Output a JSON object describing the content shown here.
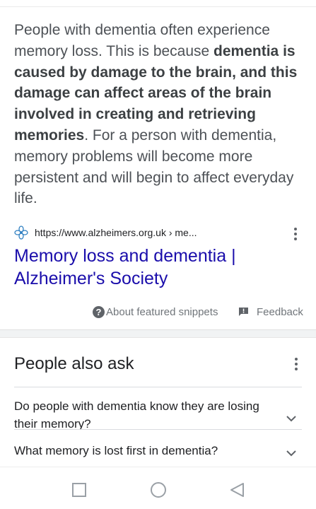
{
  "snippet": {
    "text_before": "People with dementia often experience memory loss. This is because ",
    "text_bold": "dementia is caused by damage to the brain, and this damage can affect areas of the brain involved in creating and retrieving memories",
    "text_after": ". For a person with dementia, memory problems will become more persistent and will begin to affect everyday life."
  },
  "source": {
    "url": "https://www.alzheimers.org.uk › me...",
    "favicon": "alzheimers-society-forget-me-not-icon",
    "menu_icon": "more-vert-icon"
  },
  "result": {
    "title": "Memory loss and dementia | Alzheimer's Society"
  },
  "footer": {
    "about_label": "About featured snippets",
    "about_icon_glyph": "?",
    "feedback_label": "Feedback",
    "feedback_icon": "feedback-icon"
  },
  "people_also_ask": {
    "title": "People also ask",
    "menu_icon": "more-vert-icon",
    "questions": [
      "Do people with dementia know they are losing their memory?",
      "What memory is lost first in dementia?"
    ]
  },
  "nav": {
    "recents_icon": "square-recents-icon",
    "home_icon": "circle-home-icon",
    "back_icon": "triangle-back-icon"
  },
  "colors": {
    "link": "#1a0dab",
    "text": "#4d5156",
    "favicon": "#2f7fc1"
  }
}
